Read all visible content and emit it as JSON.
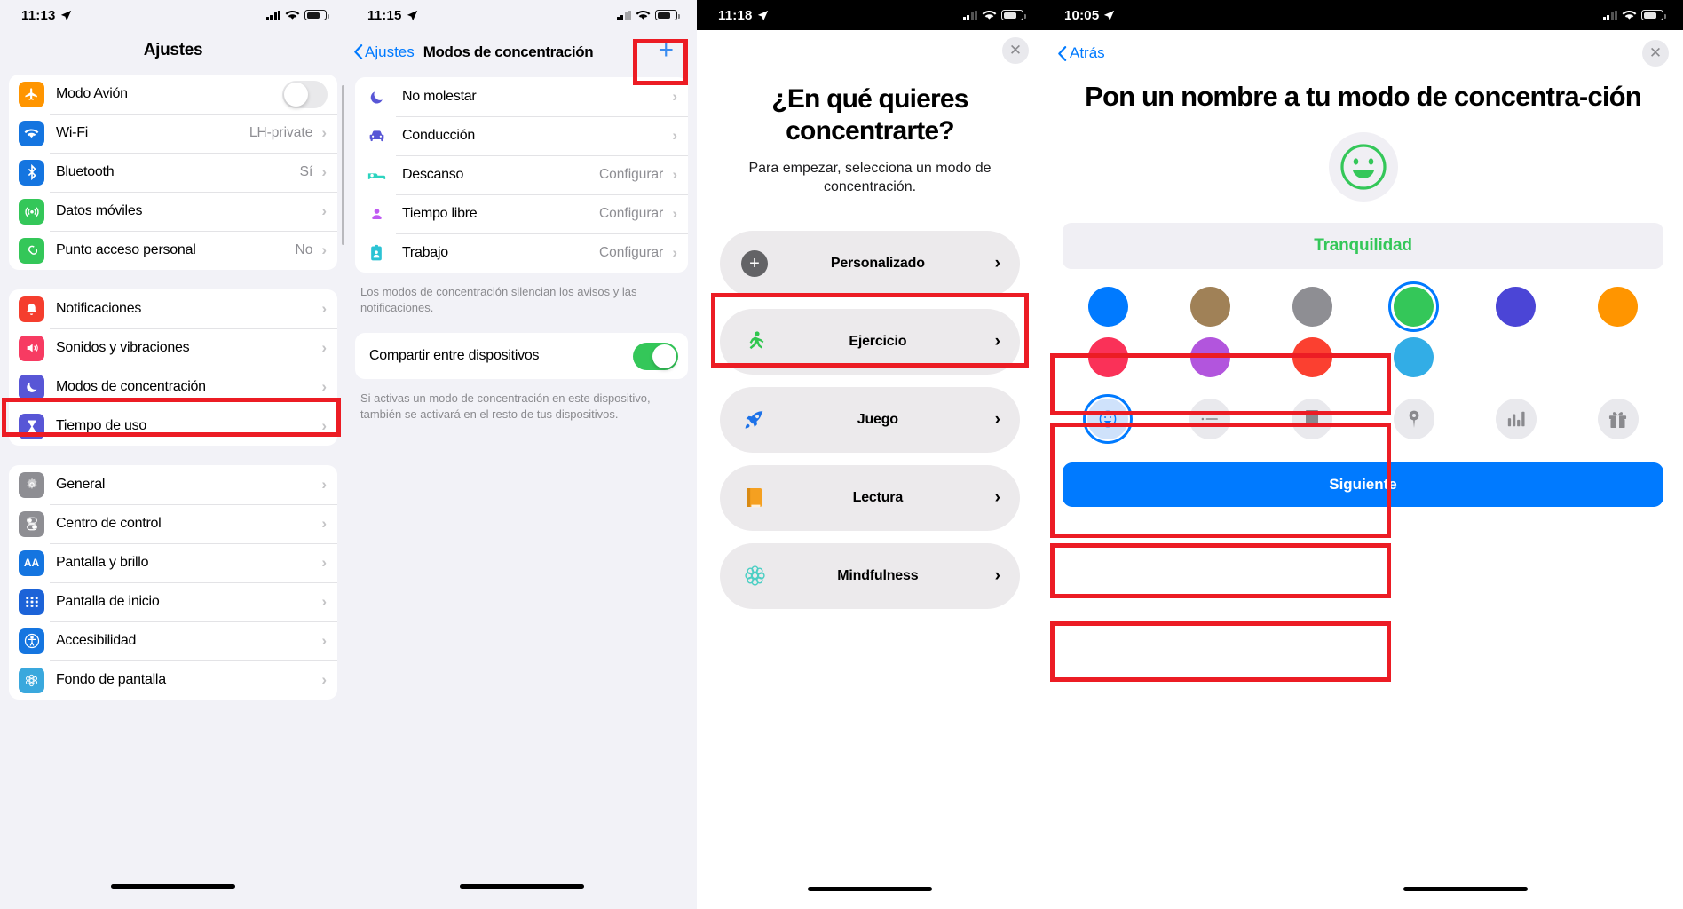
{
  "panels": {
    "settings": {
      "status": {
        "time": "11:13"
      },
      "title": "Ajustes",
      "groups": [
        {
          "rows": [
            {
              "label": "Modo Avión",
              "icon": "airplane-icon",
              "color": "#ff9500",
              "control": "toggle",
              "toggle_on": false
            },
            {
              "label": "Wi-Fi",
              "icon": "wifi-icon",
              "color": "#1575e0",
              "value": "LH-private",
              "control": "chevron"
            },
            {
              "label": "Bluetooth",
              "icon": "bluetooth-icon",
              "color": "#1575e0",
              "value": "Sí",
              "control": "chevron"
            },
            {
              "label": "Datos móviles",
              "icon": "cellular-icon",
              "color": "#34c759",
              "value": "",
              "control": "chevron"
            },
            {
              "label": "Punto acceso personal",
              "icon": "hotspot-icon",
              "color": "#34c759",
              "value": "No",
              "control": "chevron"
            }
          ]
        },
        {
          "rows": [
            {
              "label": "Notificaciones",
              "icon": "bell-icon",
              "color": "#f53e2e",
              "control": "chevron"
            },
            {
              "label": "Sonidos y vibraciones",
              "icon": "speaker-icon",
              "color": "#f73b62",
              "control": "chevron"
            },
            {
              "label": "Modos de concentración",
              "icon": "moon-icon",
              "color": "#5856d6",
              "control": "chevron",
              "highlighted": true
            },
            {
              "label": "Tiempo de uso",
              "icon": "hourglass-icon",
              "color": "#5856d6",
              "control": "chevron"
            }
          ]
        },
        {
          "rows": [
            {
              "label": "General",
              "icon": "gear-icon",
              "color": "#8e8e93",
              "control": "chevron"
            },
            {
              "label": "Centro de control",
              "icon": "sliders-icon",
              "color": "#8e8e93",
              "control": "chevron"
            },
            {
              "label": "Pantalla y brillo",
              "icon": "aa-icon",
              "color": "#1575e0",
              "control": "chevron"
            },
            {
              "label": "Pantalla de inicio",
              "icon": "grid-icon",
              "color": "#1c63d8",
              "control": "chevron"
            },
            {
              "label": "Accesibilidad",
              "icon": "accessibility-icon",
              "color": "#1575e0",
              "control": "chevron"
            },
            {
              "label": "Fondo de pantalla",
              "icon": "flower-icon",
              "color": "#3aa8dd",
              "control": "chevron"
            }
          ]
        }
      ]
    },
    "focus_list": {
      "status": {
        "time": "11:15"
      },
      "back_label": "Ajustes",
      "title": "Modos de concentración",
      "add_button": "+",
      "modes": [
        {
          "label": "No molestar",
          "icon": "moon-icon",
          "color": "#5856d6",
          "value": ""
        },
        {
          "label": "Conducción",
          "icon": "car-icon",
          "color": "#5856d6",
          "value": ""
        },
        {
          "label": "Descanso",
          "icon": "bed-icon",
          "color": "#2cd4bf",
          "value": "Configurar"
        },
        {
          "label": "Tiempo libre",
          "icon": "person-icon",
          "color": "#bf5af2",
          "value": "Configurar"
        },
        {
          "label": "Trabajo",
          "icon": "badge-icon",
          "color": "#2cc3d4",
          "value": "Configurar"
        }
      ],
      "footer_modes": "Los modos de concentración silencian los avisos y las notificaciones.",
      "share_row": {
        "label": "Compartir entre dispositivos",
        "toggle_on": true
      },
      "footer_share": "Si activas un modo de concentración en este dispositivo, también se activará en el resto de tus dispositivos."
    },
    "focus_picker": {
      "status": {
        "time": "11:18"
      },
      "close_icon": "close-icon",
      "title": "¿En qué quieres concentrarte?",
      "subtitle": "Para empezar, selecciona un modo de concentración.",
      "options": [
        {
          "label": "Personalizado",
          "icon": "plus-circle-icon",
          "highlighted": true
        },
        {
          "label": "Ejercicio",
          "icon": "runner-icon"
        },
        {
          "label": "Juego",
          "icon": "rocket-icon"
        },
        {
          "label": "Lectura",
          "icon": "book-icon"
        },
        {
          "label": "Mindfulness",
          "icon": "mindfulness-icon"
        }
      ]
    },
    "focus_name": {
      "status": {
        "time": "10:05"
      },
      "back_label": "Atrás",
      "close_icon": "close-icon",
      "title": "Pon un nombre a tu modo de concentra-ción",
      "avatar_emoji": "😀",
      "name_value": "Tranquilidad",
      "name_color": "#34c759",
      "colors": [
        {
          "hex": "#007aff",
          "name": "blue",
          "selected": false
        },
        {
          "hex": "#a08157",
          "name": "brown",
          "selected": false
        },
        {
          "hex": "#8e8e93",
          "name": "gray",
          "selected": false
        },
        {
          "hex": "#34c759",
          "name": "green",
          "selected": true
        },
        {
          "hex": "#4b45d6",
          "name": "indigo",
          "selected": false
        },
        {
          "hex": "#ff9500",
          "name": "orange",
          "selected": false
        },
        {
          "hex": "#fa3158",
          "name": "pink",
          "selected": false
        },
        {
          "hex": "#b255dd",
          "name": "purple",
          "selected": false
        },
        {
          "hex": "#fb4030",
          "name": "red",
          "selected": false
        },
        {
          "hex": "#32ade6",
          "name": "teal",
          "selected": false
        }
      ],
      "icons": [
        {
          "name": "smiley-icon",
          "glyph": "☺",
          "selected": true
        },
        {
          "name": "list-icon",
          "glyph": "☰",
          "selected": false
        },
        {
          "name": "bookmark-icon",
          "glyph": "🔖",
          "selected": false
        },
        {
          "name": "pin-icon",
          "glyph": "📍",
          "selected": false
        },
        {
          "name": "chart-icon",
          "glyph": "📊",
          "selected": false
        },
        {
          "name": "gift-icon",
          "glyph": "🎁",
          "selected": false
        }
      ],
      "next_label": "Siguiente"
    }
  }
}
